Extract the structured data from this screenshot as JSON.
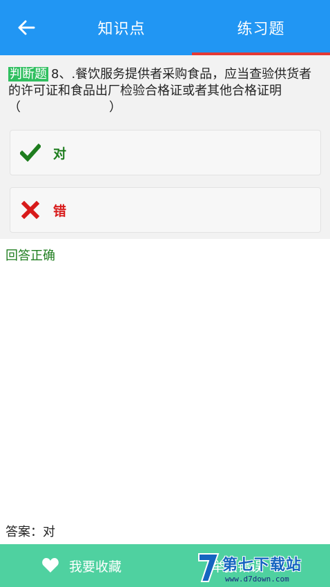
{
  "header": {
    "tabs": [
      {
        "label": "知识点",
        "active": false
      },
      {
        "label": "练习题",
        "active": true
      }
    ],
    "accent_color": "#2196f3",
    "indicator_color": "#e53935"
  },
  "question": {
    "type_badge": "判断题",
    "text": "8、.餐饮服务提供者采购食品，应当查验供货者的许可证和食品出厂检验合格证或者其他合格证明",
    "paren_open": "（",
    "paren_close": "）"
  },
  "options": [
    {
      "label": "对",
      "icon": "check-icon",
      "color": "#1e7d1e"
    },
    {
      "label": "错",
      "icon": "cross-icon",
      "color": "#d81b1b"
    }
  ],
  "result_text": "回答正确",
  "answer_text": "答案：对",
  "footer": {
    "favorite_label": "我要收藏",
    "report_label": "举报错误",
    "color": "#4fd1a0"
  },
  "watermark": {
    "text": "第七下载站",
    "url": "www.d7down.com"
  }
}
